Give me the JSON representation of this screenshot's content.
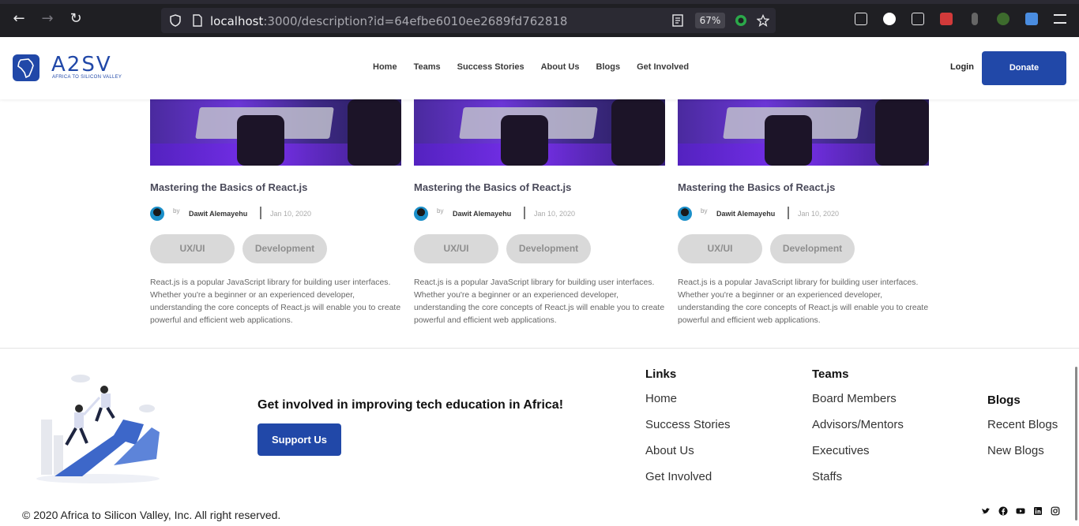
{
  "browser": {
    "url_host": "localhost",
    "url_rest": ":3000/description?id=64efbe6010ee2689fd762818",
    "zoom": "67%"
  },
  "header": {
    "logo_text": "A2SV",
    "logo_subtext": "AFRICA TO SILICON VALLEY",
    "nav": [
      "Home",
      "Teams",
      "Success Stories",
      "About Us",
      "Blogs",
      "Get Involved"
    ],
    "login": "Login",
    "donate": "Donate"
  },
  "cards": [
    {
      "title": "Mastering the Basics of React.js",
      "by": "by",
      "author": "Dawit Alemayehu",
      "date": "Jan 10, 2020",
      "tags": [
        "UX/UI",
        "Development"
      ],
      "description": "React.js is a popular JavaScript library for building user interfaces. Whether you're a beginner or an experienced developer, understanding the core concepts of React.js will enable you to create powerful and efficient web applications."
    },
    {
      "title": "Mastering the Basics of React.js",
      "by": "by",
      "author": "Dawit Alemayehu",
      "date": "Jan 10, 2020",
      "tags": [
        "UX/UI",
        "Development"
      ],
      "description": "React.js is a popular JavaScript library for building user interfaces. Whether you're a beginner or an experienced developer, understanding the core concepts of React.js will enable you to create powerful and efficient web applications."
    },
    {
      "title": "Mastering the Basics of React.js",
      "by": "by",
      "author": "Dawit Alemayehu",
      "date": "Jan 10, 2020",
      "tags": [
        "UX/UI",
        "Development"
      ],
      "description": "React.js is a popular JavaScript library for building user interfaces. Whether you're a beginner or an experienced developer, understanding the core concepts of React.js will enable you to create powerful and efficient web applications."
    }
  ],
  "footer": {
    "cta": "Get involved in improving tech education in Africa!",
    "support_button": "Support Us",
    "links": {
      "heading": "Links",
      "items": [
        "Home",
        "Success Stories",
        "About Us",
        "Get Involved"
      ]
    },
    "teams": {
      "heading": "Teams",
      "items": [
        "Board Members",
        "Advisors/Mentors",
        "Executives",
        "Staffs"
      ]
    },
    "blogs": {
      "heading": "Blogs",
      "items": [
        "Recent Blogs",
        "New Blogs"
      ]
    },
    "copyright": "© 2020 Africa to Silicon Valley, Inc. All right reserved.",
    "socials": [
      "twitter-icon",
      "facebook-icon",
      "youtube-icon",
      "linkedin-icon",
      "instagram-icon"
    ]
  },
  "colors": {
    "brand": "#2148a8",
    "tag_bg": "#d9d9d9",
    "browser_bg": "#1f1f23"
  }
}
